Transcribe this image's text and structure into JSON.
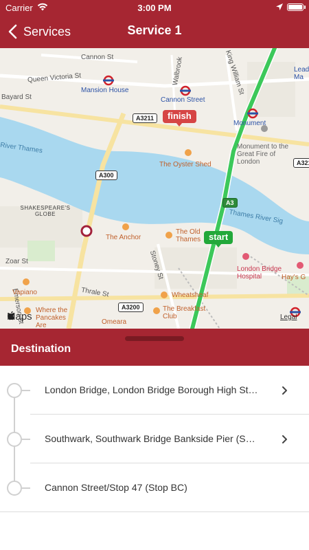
{
  "status_bar": {
    "carrier": "Carrier",
    "time": "3:00 PM",
    "wifi_icon": "wifi-icon",
    "battery_icon": "battery-icon",
    "location_icon": "location-arrow-icon"
  },
  "nav": {
    "back_label": "Services",
    "title": "Service 1",
    "back_icon": "chevron-left-icon"
  },
  "map": {
    "streets": [
      "Cannon St",
      "Queen Victoria St",
      "Walbrook",
      "King William St",
      "Bayard St",
      "Zoar St",
      "Thrale St",
      "Stoney St",
      "Emerson St"
    ],
    "road_shields": [
      "A3211",
      "A300",
      "A3",
      "A3200",
      "A321"
    ],
    "river_labels": [
      "River Thames",
      "Thames River Sig"
    ],
    "stations": [
      "Mansion House",
      "Cannon Street",
      "Monument"
    ],
    "pois": [
      "The Oyster Shed",
      "The Anchor",
      "The Old Thames",
      "Wheatsheaf",
      "The Breakfast Club",
      "Vapiano",
      "Where the Pancakes Are",
      "Omeara",
      "Hay's G"
    ],
    "landmarks": [
      "SHAKESPEARE'S GLOBE",
      "Monument to the Great Fire of London",
      "London Bridge Hospital",
      "Lead Ma"
    ],
    "finish_label": "finish",
    "start_label": "start",
    "maps_brand": "Maps",
    "legal": "Legal"
  },
  "sheet": {
    "title": "Destination"
  },
  "destinations": [
    {
      "text": "London Bridge, London Bridge Borough High St…",
      "has_chevron": true
    },
    {
      "text": "Southwark, Southwark Bridge  Bankside Pier (S…",
      "has_chevron": true
    },
    {
      "text": "Cannon Street/Stop 47 (Stop BC)",
      "has_chevron": false
    }
  ],
  "colors": {
    "header": "#a62632",
    "route": "#3cc85a",
    "river": "#a9d8ef",
    "finish_pin": "#d64545",
    "start_pin": "#22a83a"
  }
}
